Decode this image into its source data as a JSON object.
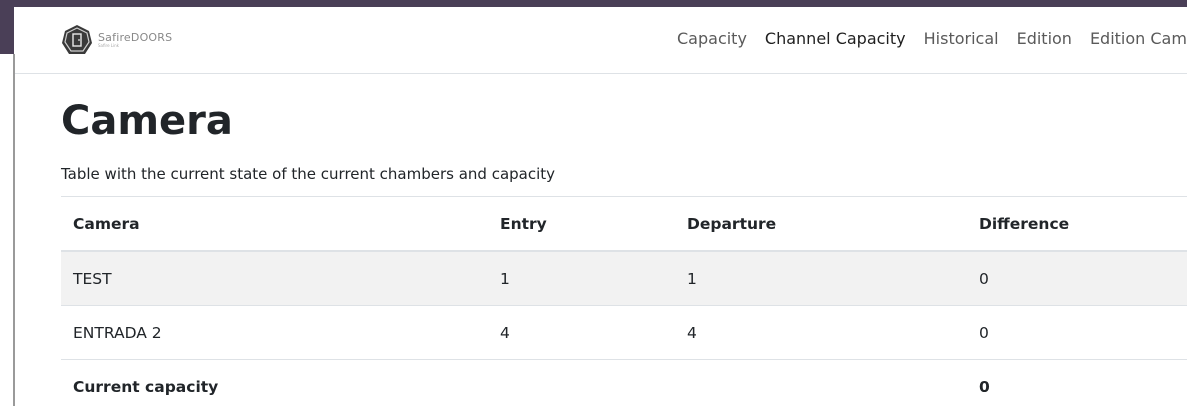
{
  "brand": {
    "name": "SafireDOORS",
    "tagline": "Safire Link"
  },
  "nav": {
    "items": [
      {
        "label": "Capacity"
      },
      {
        "label": "Channel Capacity"
      },
      {
        "label": "Historical"
      },
      {
        "label": "Edition"
      },
      {
        "label": "Edition Cameras"
      }
    ]
  },
  "page": {
    "title": "Camera",
    "description": "Table with the current state of the current chambers and capacity"
  },
  "table": {
    "headers": [
      "Camera",
      "Entry",
      "Departure",
      "Difference"
    ],
    "rows": [
      {
        "camera": "TEST",
        "entry": "1",
        "departure": "1",
        "difference": "0"
      },
      {
        "camera": "ENTRADA 2",
        "entry": "4",
        "departure": "4",
        "difference": "0"
      }
    ],
    "total": {
      "label": "Current capacity",
      "difference": "0"
    }
  },
  "colors": {
    "backdrop": "#4a3f57",
    "stripe": "#f2f2f2",
    "border": "#dee2e6",
    "text": "#212529"
  }
}
